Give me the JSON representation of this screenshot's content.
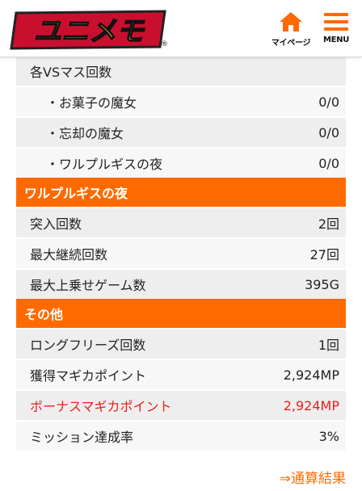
{
  "header": {
    "logo_text": "ユニメモ",
    "logo_mark": "®",
    "mypage_label": "マイページ",
    "menu_label": "MENU"
  },
  "colors": {
    "accent": "#ff6a00",
    "highlight_red": "#e8201a"
  },
  "rows_top": [
    {
      "label": "各VSマス回数",
      "value": ""
    },
    {
      "label": "・お菓子の魔女",
      "value": "0/0"
    },
    {
      "label": "・忘却の魔女",
      "value": "0/0"
    },
    {
      "label": "・ワルプルギスの夜",
      "value": "0/0"
    }
  ],
  "section_walpurgis": {
    "title": "ワルプルギスの夜",
    "rows": [
      {
        "label": "突入回数",
        "value": "2回"
      },
      {
        "label": "最大継続回数",
        "value": "27回"
      },
      {
        "label": "最大上乗せゲーム数",
        "value": "395G"
      }
    ]
  },
  "section_other": {
    "title": "その他",
    "rows": [
      {
        "label": "ロングフリーズ回数",
        "value": "1回"
      },
      {
        "label": "獲得マギカポイント",
        "value": "2,924MP"
      },
      {
        "label": "ボーナスマギカポイント",
        "value": "2,924MP"
      },
      {
        "label": "ミッション達成率",
        "value": "3%"
      }
    ]
  },
  "footer": {
    "link_label": "⇒通算結果"
  }
}
